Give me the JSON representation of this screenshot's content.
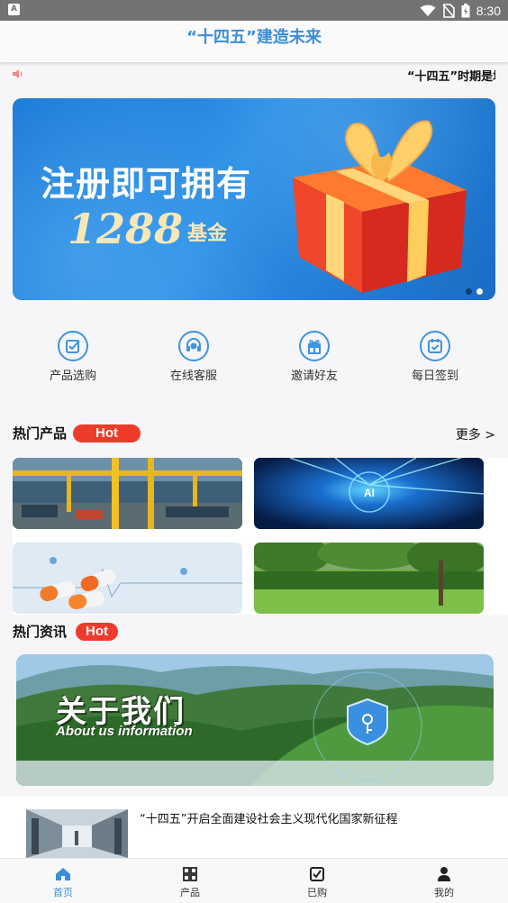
{
  "status_bar": {
    "time": "8:30",
    "app_badge": "A"
  },
  "header": {
    "title": "“十四五”建造未来"
  },
  "marquee": {
    "text": "“十四五”时期是增强经济社会发展新动能的关键时期",
    "speaker_icon": "speaker-icon"
  },
  "banner": {
    "headline": "注册即可拥有",
    "amount": "1288",
    "amount_unit": "基金",
    "slide_count": 2,
    "active_slide": 2
  },
  "quick_actions": [
    {
      "label": "产品选购",
      "icon": "checkbox-icon"
    },
    {
      "label": "在线客服",
      "icon": "headset-icon"
    },
    {
      "label": "邀请好友",
      "icon": "gift-icon"
    },
    {
      "label": "每日签到",
      "icon": "calendar-check-icon"
    }
  ],
  "hot_products": {
    "title": "热门产品",
    "badge": "Hot",
    "more": "更多 >",
    "items": [
      {
        "name": "factory",
        "icon": "factory-image"
      },
      {
        "name": "ai",
        "icon": "ai-image",
        "overlay": "AI"
      },
      {
        "name": "pills",
        "icon": "medicine-image"
      },
      {
        "name": "garden",
        "icon": "garden-image"
      }
    ]
  },
  "hot_news": {
    "title": "热门资讯",
    "badge": "Hot",
    "banner_title": "关于我们",
    "banner_subtitle": "About us information",
    "items": [
      {
        "headline": "“十四五”开启全面建设社会主义现代化国家新征程"
      }
    ]
  },
  "tab_bar": {
    "active": 0,
    "items": [
      {
        "label": "首页",
        "icon": "home-icon"
      },
      {
        "label": "产品",
        "icon": "grid-icon"
      },
      {
        "label": "已购",
        "icon": "checkbox-icon"
      },
      {
        "label": "我的",
        "icon": "user-icon"
      }
    ]
  },
  "colors": {
    "accent": "#3b8fd9",
    "hot_badge": "#ee3b2b",
    "status_bar": "#737373"
  }
}
